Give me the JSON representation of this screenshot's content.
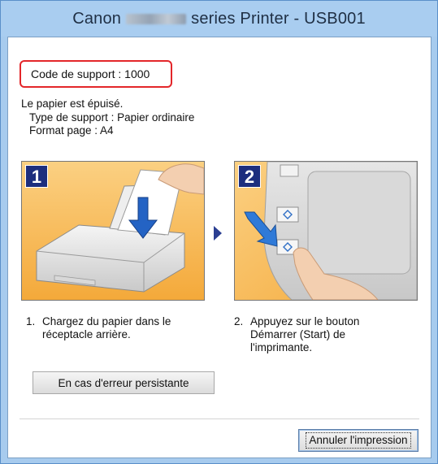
{
  "window": {
    "title_prefix": "Canon",
    "title_suffix": "series Printer - USB001"
  },
  "support_code": "Code de support : 1000",
  "message": {
    "line1": "Le papier est épuisé.",
    "line2": "Type de support : Papier ordinaire",
    "line3": "Format page : A4"
  },
  "steps": [
    {
      "badge": "1",
      "number": "1.",
      "text": "Chargez du papier dans le réceptacle arrière."
    },
    {
      "badge": "2",
      "number": "2.",
      "text": "Appuyez sur le bouton Démarrer (Start) de l'imprimante."
    }
  ],
  "buttons": {
    "persistent_error": "En cas d'erreur persistante",
    "cancel_print": "Annuler l'impression"
  },
  "colors": {
    "highlight_border": "#e3262a",
    "step_badge": "#1d2e7e",
    "panel_background": "#f7b548",
    "titlebar": "#a9cdf0"
  }
}
